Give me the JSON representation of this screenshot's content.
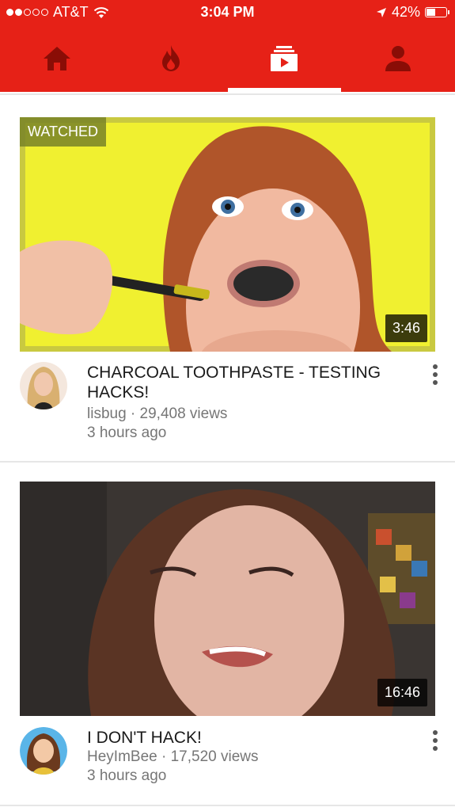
{
  "status_bar": {
    "carrier": "AT&T",
    "time": "3:04 PM",
    "battery": "42%"
  },
  "tabs": [
    {
      "name": "home",
      "icon": "home-icon",
      "active": false
    },
    {
      "name": "trending",
      "icon": "flame-icon",
      "active": false
    },
    {
      "name": "subscriptions",
      "icon": "subscriptions-icon",
      "active": true
    },
    {
      "name": "account",
      "icon": "person-icon",
      "active": false
    }
  ],
  "videos": [
    {
      "title": "CHARCOAL TOOTHPASTE - TESTING HACKS!",
      "channel": "lisbug",
      "views": "29,408 views",
      "channel_views": "lisbug · 29,408 views",
      "age": "3 hours ago",
      "duration": "3:46",
      "badge": "WATCHED"
    },
    {
      "title": "I DON'T HACK!",
      "channel": "HeyImBee",
      "views": "17,520 views",
      "channel_views": "HeyImBee · 17,520 views",
      "age": "3 hours ago",
      "duration": "16:46"
    }
  ],
  "colors": {
    "brand_red": "#e62117",
    "thumb1_bg": "#f0f030",
    "thumb2_bg": "#4a3a30"
  }
}
